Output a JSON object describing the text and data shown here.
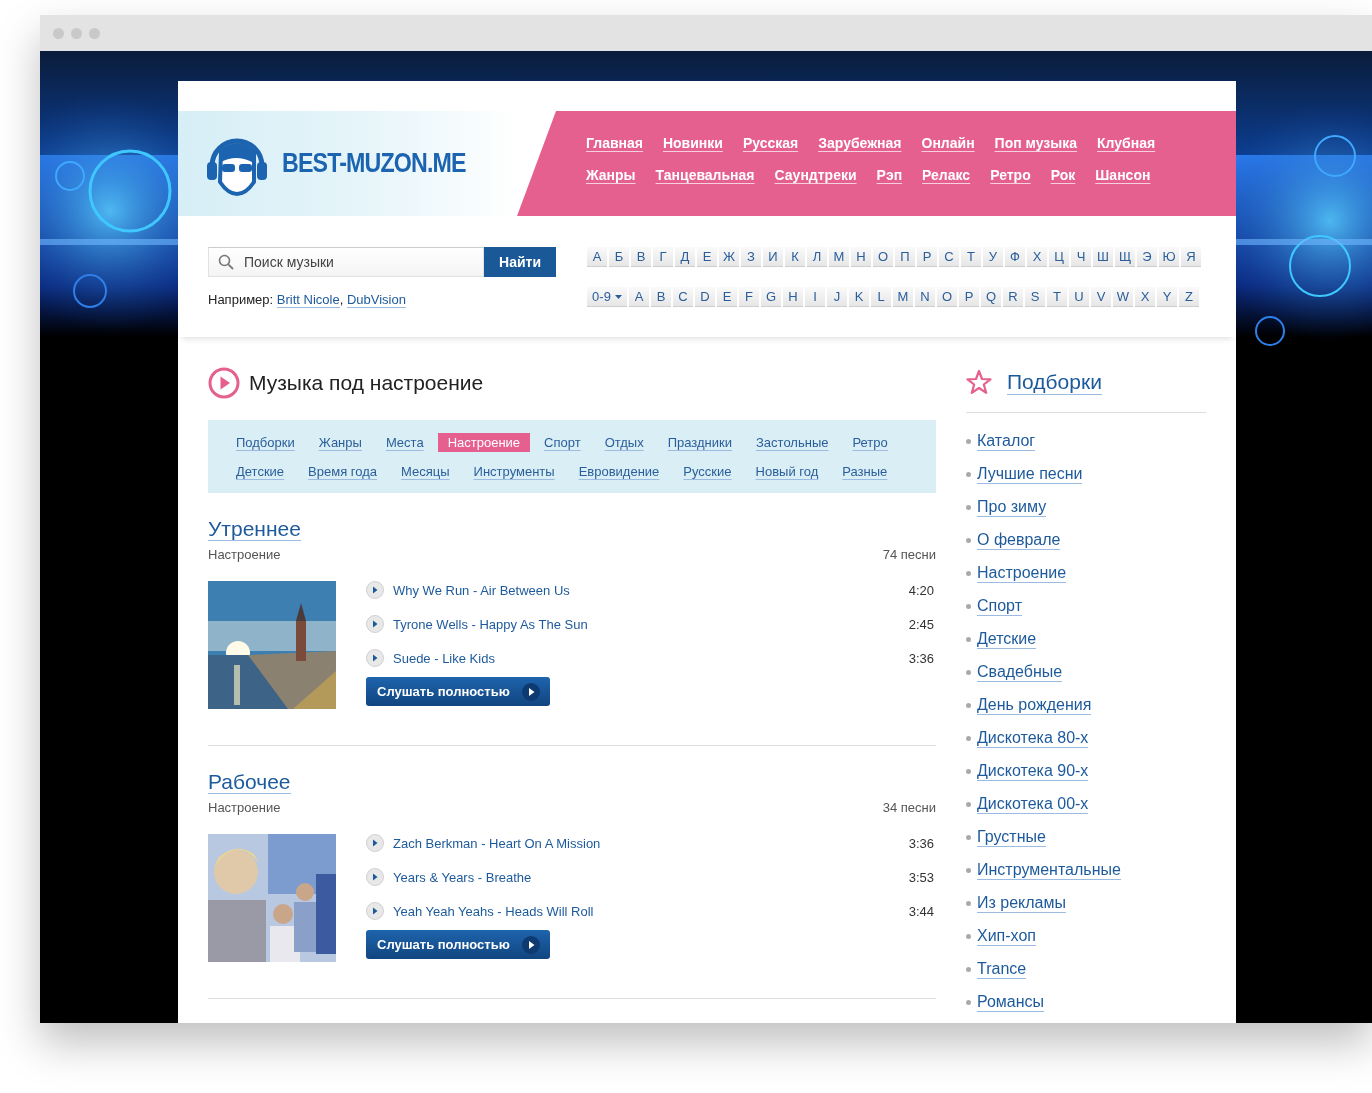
{
  "site": {
    "logo": "BEST-MUZON.ME",
    "nav": [
      "Главная",
      "Новинки",
      "Русская",
      "Зарубежная",
      "Онлайн",
      "Поп музыка",
      "Клубная",
      "Жанры",
      "Танцевальная",
      "Саундтреки",
      "Рэп",
      "Релакс",
      "Ретро",
      "Рок",
      "Шансон"
    ],
    "search": {
      "placeholder": "Поиск музыки",
      "button": "Найти"
    },
    "examples": {
      "label": "Например:",
      "links": [
        "Britt Nicole",
        "DubVision"
      ],
      "separator": ","
    },
    "alphabet_ru": [
      "А",
      "Б",
      "В",
      "Г",
      "Д",
      "Е",
      "Ж",
      "З",
      "И",
      "К",
      "Л",
      "М",
      "Н",
      "О",
      "П",
      "Р",
      "С",
      "Т",
      "У",
      "Ф",
      "Х",
      "Ц",
      "Ч",
      "Ш",
      "Щ",
      "Э",
      "Ю",
      "Я"
    ],
    "alphabet_lat": {
      "dropdown": "0-9",
      "letters": [
        "A",
        "B",
        "C",
        "D",
        "E",
        "F",
        "G",
        "H",
        "I",
        "J",
        "K",
        "L",
        "M",
        "N",
        "O",
        "P",
        "Q",
        "R",
        "S",
        "T",
        "U",
        "V",
        "W",
        "X",
        "Y",
        "Z"
      ]
    }
  },
  "main": {
    "title": "Музыка под настроение",
    "tags": [
      {
        "label": "Подборки",
        "selected": false
      },
      {
        "label": "Жанры",
        "selected": false
      },
      {
        "label": "Места",
        "selected": false
      },
      {
        "label": "Настроение",
        "selected": true
      },
      {
        "label": "Спорт",
        "selected": false
      },
      {
        "label": "Отдых",
        "selected": false
      },
      {
        "label": "Праздники",
        "selected": false
      },
      {
        "label": "Застольные",
        "selected": false
      },
      {
        "label": "Ретро",
        "selected": false
      },
      {
        "label": "Детские",
        "selected": false
      },
      {
        "label": "Время года",
        "selected": false
      },
      {
        "label": "Месяцы",
        "selected": false
      },
      {
        "label": "Инструменты",
        "selected": false
      },
      {
        "label": "Евровидение",
        "selected": false
      },
      {
        "label": "Русские",
        "selected": false
      },
      {
        "label": "Новый год",
        "selected": false
      },
      {
        "label": "Разные",
        "selected": false
      }
    ],
    "playlists": [
      {
        "title": "Утреннее",
        "category": "Настроение",
        "count": "74 песни",
        "button": "Слушать полностью",
        "tracks": [
          {
            "title": "Why We Run - Air Between Us",
            "duration": "4:20"
          },
          {
            "title": "Tyrone Wells - Happy As The Sun",
            "duration": "2:45"
          },
          {
            "title": "Suede - Like Kids",
            "duration": "3:36"
          }
        ]
      },
      {
        "title": "Рабочее",
        "category": "Настроение",
        "count": "34 песни",
        "button": "Слушать полностью",
        "tracks": [
          {
            "title": "Zach Berkman - Heart On A Mission",
            "duration": "3:36"
          },
          {
            "title": "Years & Years - Breathe",
            "duration": "3:53"
          },
          {
            "title": "Yeah Yeah Yeahs - Heads Will Roll",
            "duration": "3:44"
          }
        ]
      }
    ]
  },
  "sidebar": {
    "title": "Подборки",
    "items": [
      "Каталог",
      "Лучшие песни",
      "Про зиму",
      "О феврале",
      "Настроение",
      "Спорт",
      "Детские",
      "Свадебные",
      "День рождения",
      "Дискотека 80-х",
      "Дискотека 90-х",
      "Дискотека 00-х",
      "Грустные",
      "Инструментальные",
      "Из рекламы",
      "Хип-хоп",
      "Trance",
      "Романсы"
    ]
  }
}
